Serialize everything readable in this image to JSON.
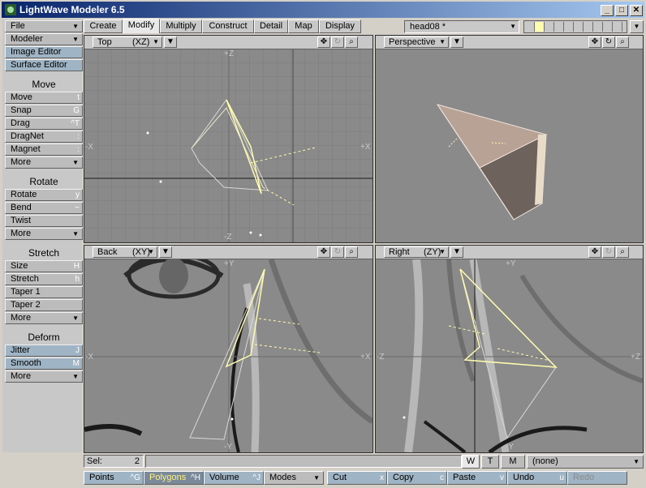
{
  "window": {
    "title": "LightWave Modeler 6.5",
    "min": "_",
    "max": "□",
    "close": "✕"
  },
  "sidebar": {
    "top_buttons": [
      {
        "label": "File",
        "arrow": true
      },
      {
        "label": "Modeler",
        "arrow": true
      },
      {
        "label": "Image Editor"
      },
      {
        "label": "Surface Editor"
      }
    ],
    "groups": [
      {
        "heading": "Move",
        "items": [
          {
            "label": "Move",
            "shortcut": "t"
          },
          {
            "label": "Snap",
            "shortcut": "G"
          },
          {
            "label": "Drag",
            "shortcut": "^T"
          },
          {
            "label": "DragNet",
            "shortcut": ":"
          },
          {
            "label": "Magnet",
            "shortcut": ":"
          },
          {
            "label": "More",
            "arrow": true
          }
        ]
      },
      {
        "heading": "Rotate",
        "items": [
          {
            "label": "Rotate",
            "shortcut": "y"
          },
          {
            "label": "Bend",
            "shortcut": "~"
          },
          {
            "label": "Twist",
            "shortcut": ""
          },
          {
            "label": "More",
            "arrow": true
          }
        ]
      },
      {
        "heading": "Stretch",
        "items": [
          {
            "label": "Size",
            "shortcut": "H"
          },
          {
            "label": "Stretch",
            "shortcut": "h"
          },
          {
            "label": "Taper 1",
            "shortcut": ""
          },
          {
            "label": "Taper 2",
            "shortcut": ""
          },
          {
            "label": "More",
            "arrow": true
          }
        ]
      },
      {
        "heading": "Deform",
        "items": [
          {
            "label": "Jitter",
            "shortcut": "J"
          },
          {
            "label": "Smooth",
            "shortcut": "M"
          },
          {
            "label": "More",
            "arrow": true
          }
        ]
      }
    ]
  },
  "tabs": [
    "Create",
    "Modify",
    "Multiply",
    "Construct",
    "Detail",
    "Map",
    "Display"
  ],
  "active_tab": "Modify",
  "object": {
    "name": "head08 *"
  },
  "viewports": [
    {
      "mode": "Top",
      "axes": "(XZ)",
      "labels": {
        "top": "+Z",
        "bottom": "-Z",
        "left": "-X",
        "right": "+X"
      }
    },
    {
      "mode": "Perspective",
      "axes": "",
      "labels": {}
    },
    {
      "mode": "Back",
      "axes": "(XY)",
      "labels": {
        "top": "+Y",
        "bottom": "-Y",
        "left": "-X",
        "right": "+X"
      }
    },
    {
      "mode": "Right",
      "axes": "(ZY)",
      "labels": {
        "top": "+Y",
        "bottom": "-Y",
        "left": "-Z",
        "right": "+Z"
      }
    }
  ],
  "status": {
    "sel_label": "Sel:",
    "sel_value": "2",
    "wtm": [
      "W",
      "T",
      "M"
    ],
    "active_wtm": "W",
    "none_label": "(none)"
  },
  "bottom": {
    "points": {
      "label": "Points",
      "shortcut": "^G"
    },
    "polygons": {
      "label": "Polygons",
      "shortcut": "^H"
    },
    "volume": {
      "label": "Volume",
      "shortcut": "^J"
    },
    "modes": {
      "label": "Modes"
    },
    "cut": {
      "label": "Cut",
      "shortcut": "x"
    },
    "copy": {
      "label": "Copy",
      "shortcut": "c"
    },
    "paste": {
      "label": "Paste",
      "shortcut": "v"
    },
    "undo": {
      "label": "Undo",
      "shortcut": "u"
    },
    "redo": {
      "label": "Redo"
    }
  },
  "colors": {
    "title_start": "#08246b",
    "title_end": "#a5c8ef",
    "viewport_bg": "#8a8a8a",
    "wire": "#f5f5c0",
    "selected_poly": "#fffcae"
  }
}
